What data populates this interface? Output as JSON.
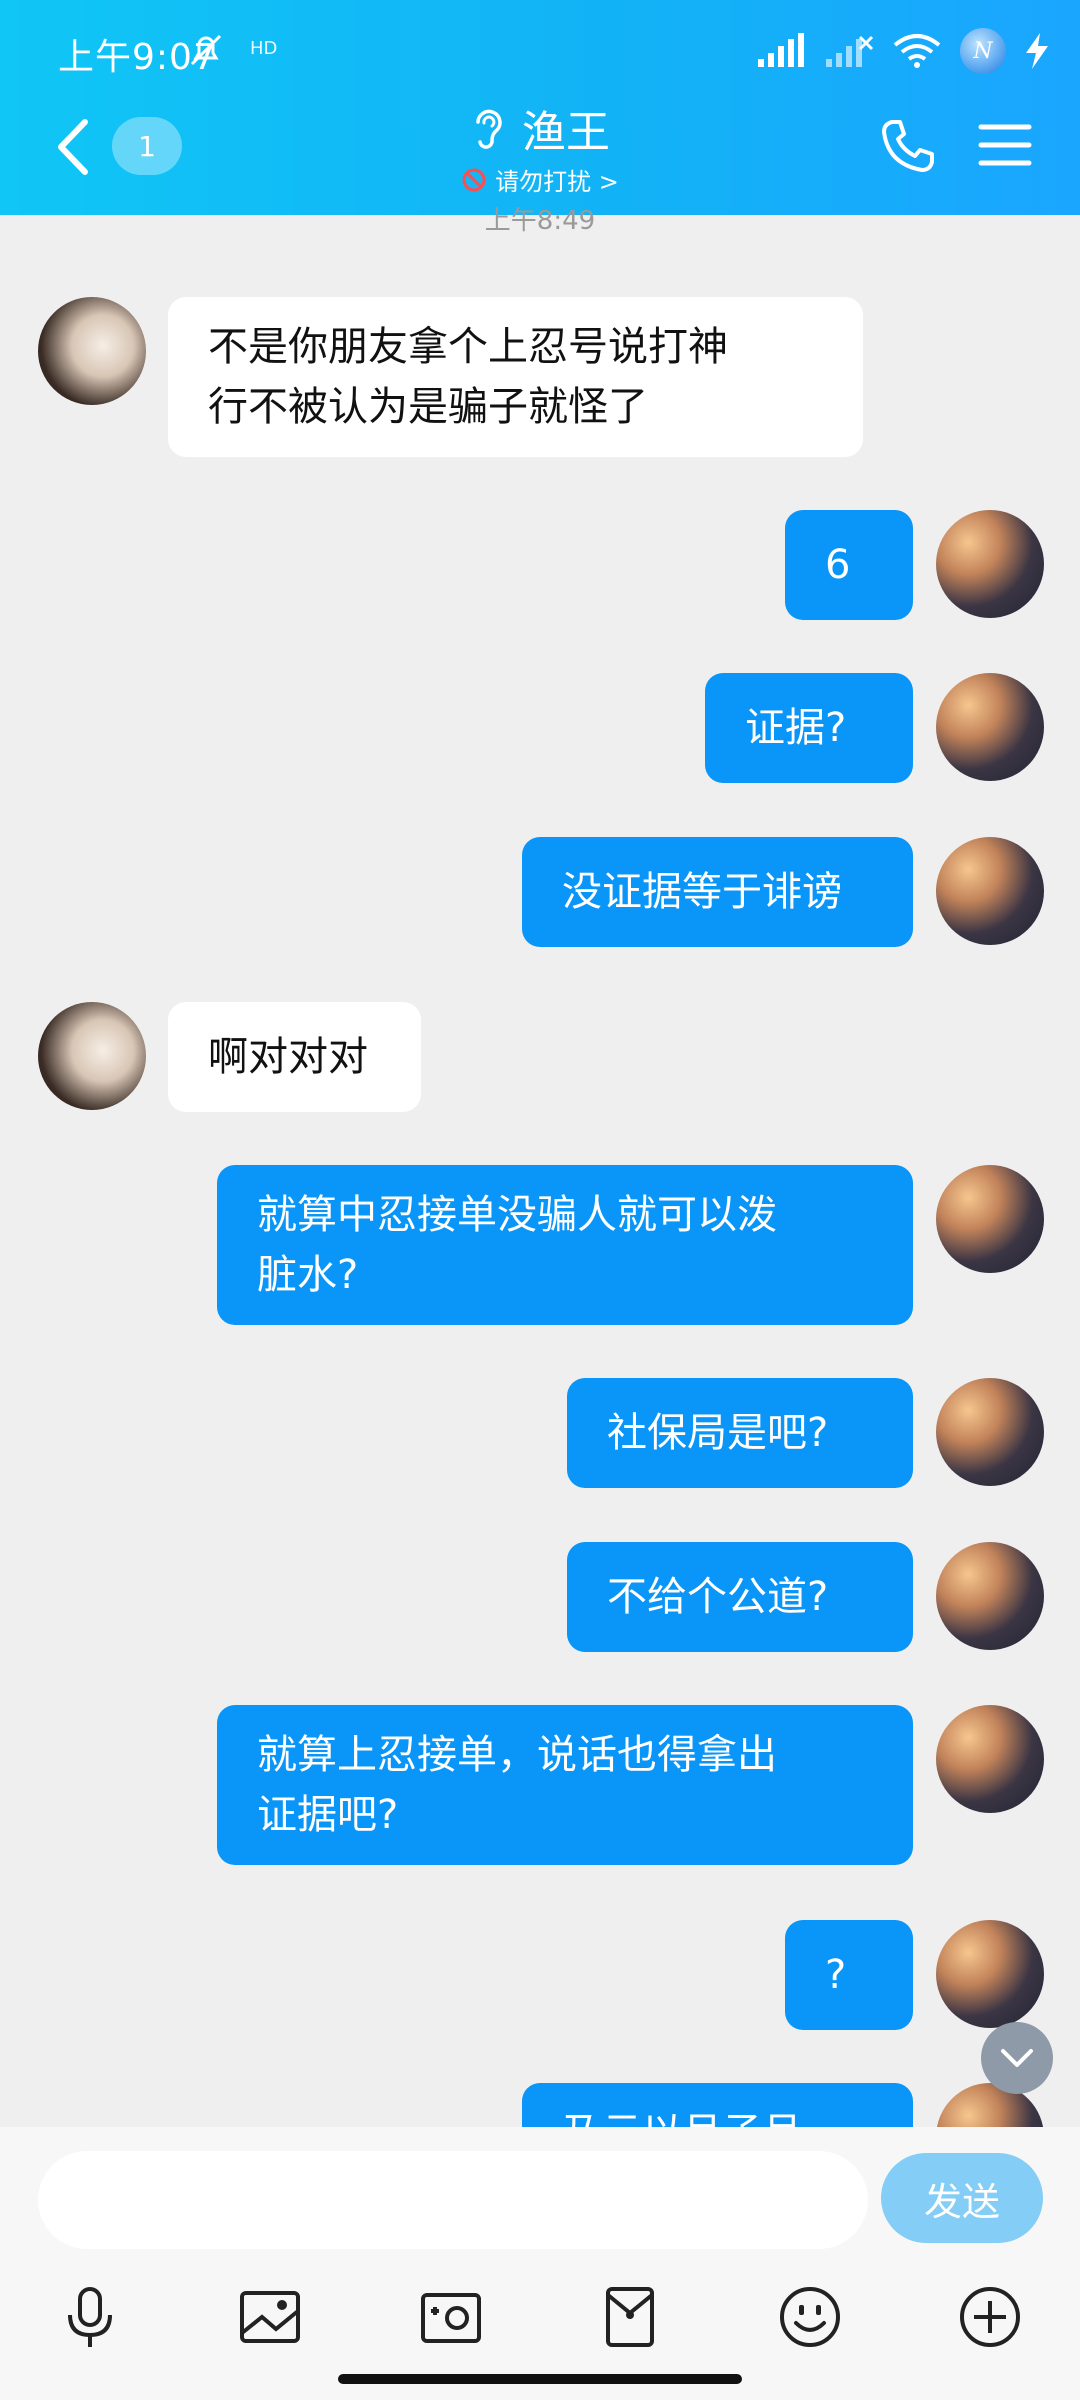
{
  "status_bar": {
    "time": "上午9:07",
    "extra": "HD",
    "badge": "N"
  },
  "header": {
    "unread_count": "1",
    "title": "渔王",
    "subtitle": "请勿打扰 >"
  },
  "timestamp": "上午8:49",
  "messages": [
    {
      "side": "in",
      "text": "不是你朋友拿个上忍号说打神\n行不被认为是骗子就怪了"
    },
    {
      "side": "out",
      "text": "6"
    },
    {
      "side": "out",
      "text": "证据?"
    },
    {
      "side": "out",
      "text": "没证据等于诽谤"
    },
    {
      "side": "in",
      "text": "啊对对对"
    },
    {
      "side": "out",
      "text": "就算中忍接单没骗人就可以泼\n脏水?"
    },
    {
      "side": "out",
      "text": "社保局是吧?"
    },
    {
      "side": "out",
      "text": "不给个公道?"
    },
    {
      "side": "out",
      "text": "就算上忍接单，说话也得拿出\n证据吧?"
    },
    {
      "side": "out",
      "text": "?"
    },
    {
      "side": "out",
      "text": "乃云以月子月"
    }
  ],
  "input": {
    "placeholder": "",
    "value": ""
  },
  "send_label": "发送",
  "colors": {
    "header_start": "#10c6f6",
    "header_end": "#1aa6ff",
    "outgoing": "#0a95f8",
    "incoming": "#ffffff",
    "send": "#83cdf6"
  }
}
